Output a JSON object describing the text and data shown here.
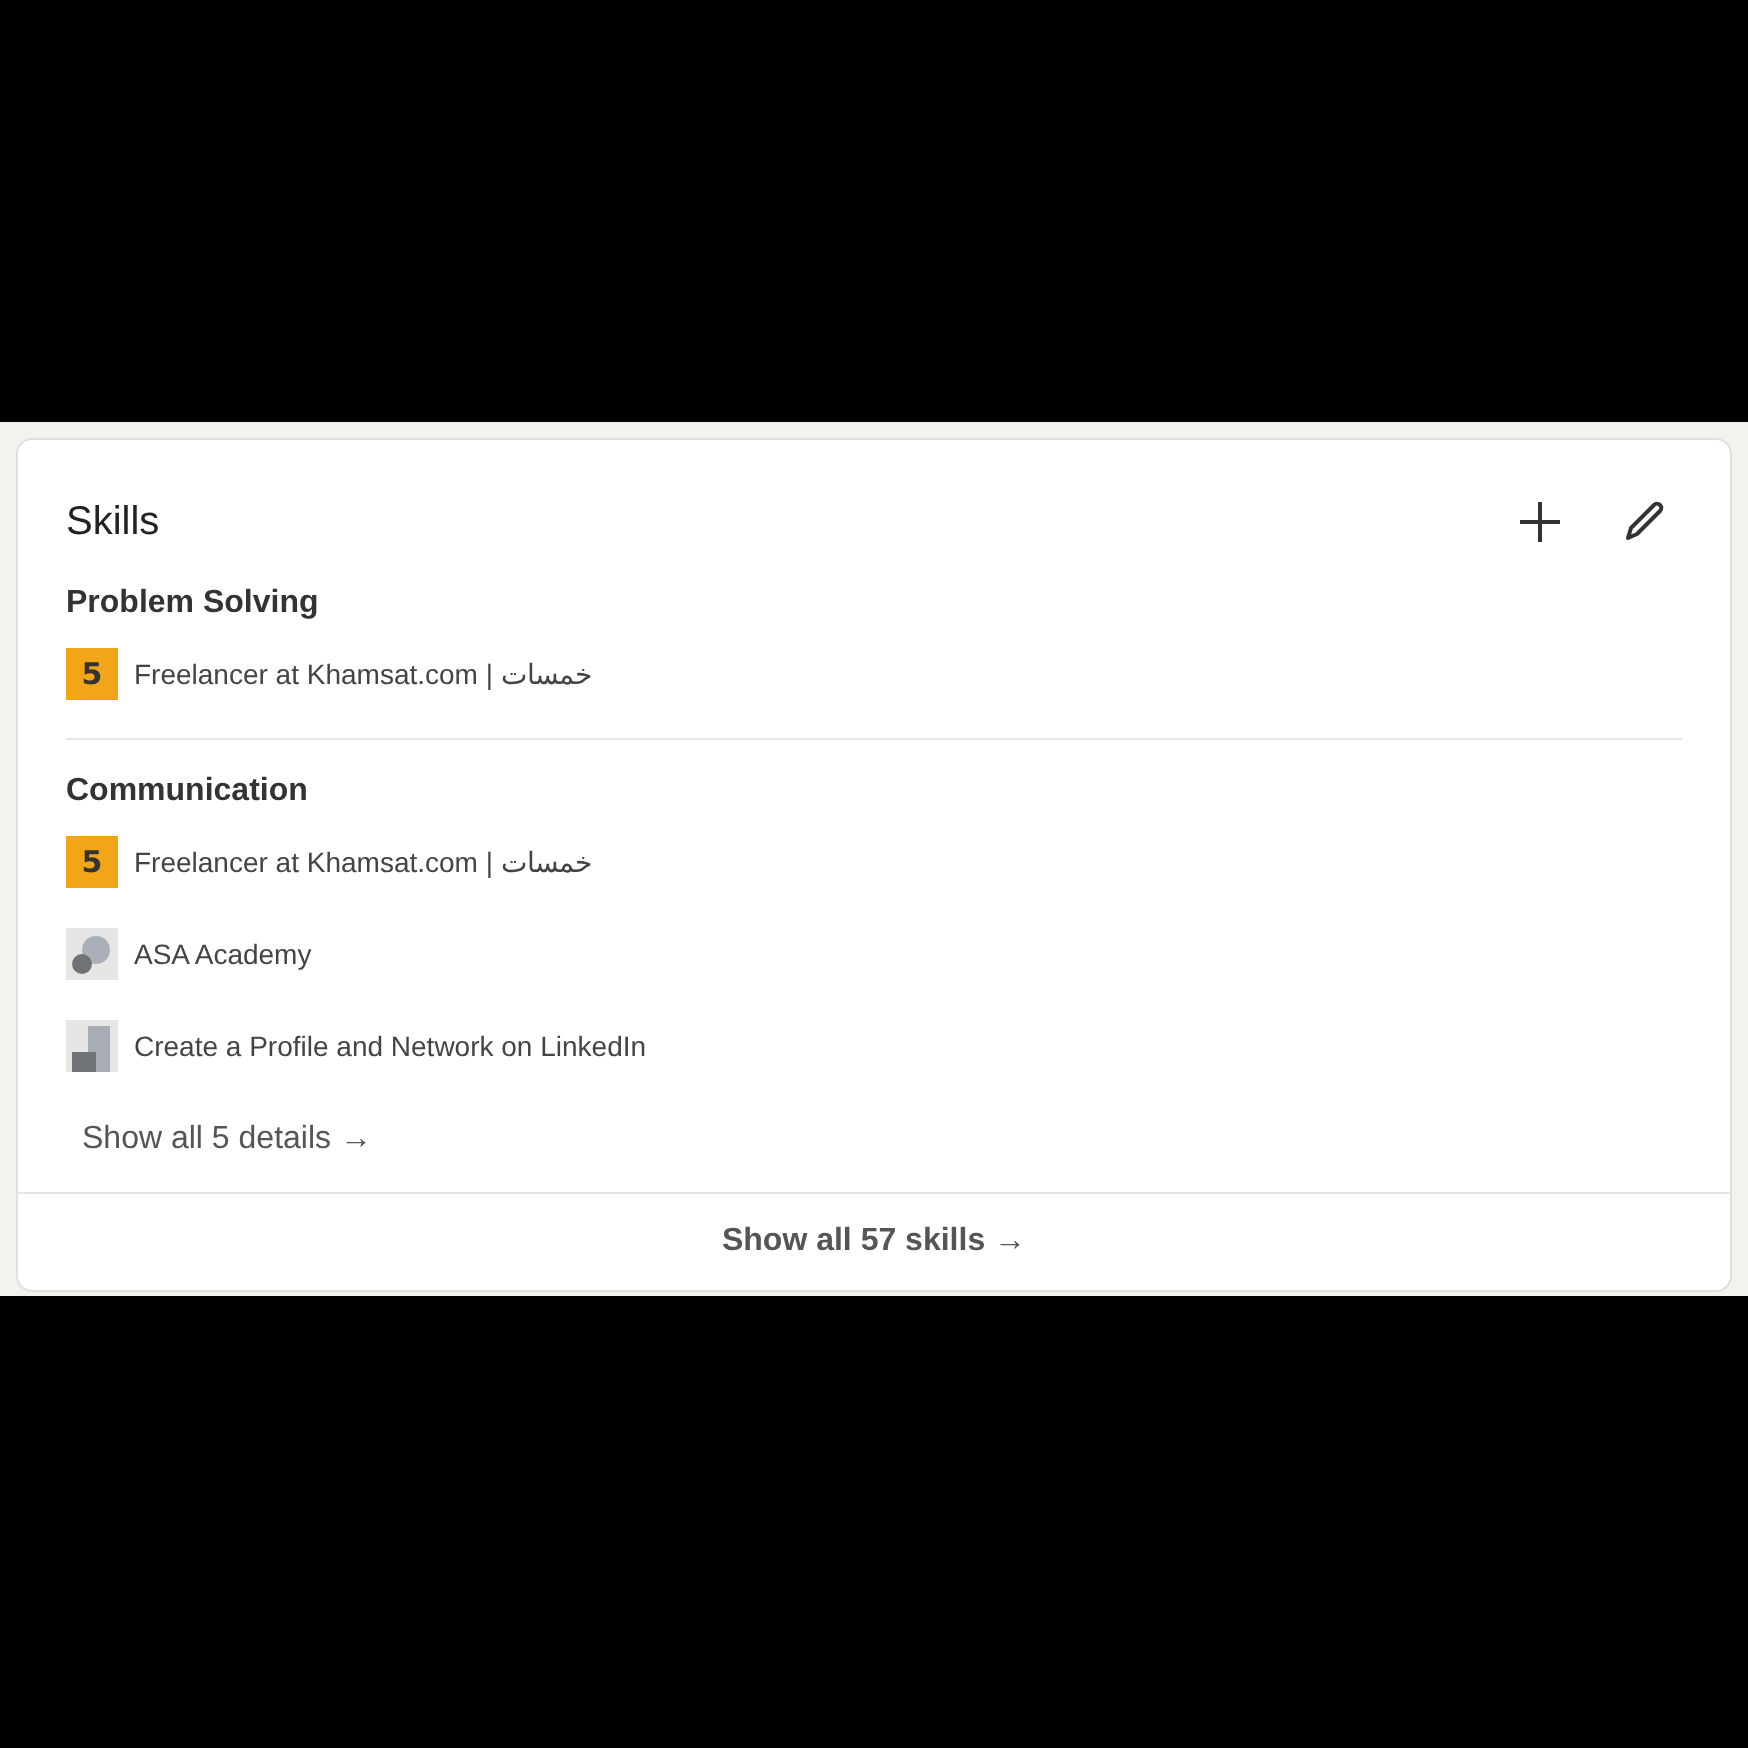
{
  "card": {
    "title": "Skills",
    "skills": [
      {
        "name": "Problem Solving",
        "items": [
          {
            "logo": {
              "kind": "letter",
              "text": "5"
            },
            "label": "Freelancer at Khamsat.com | خمسات"
          }
        ]
      },
      {
        "name": "Communication",
        "items": [
          {
            "logo": {
              "kind": "letter",
              "text": "5"
            },
            "label": "Freelancer at Khamsat.com | خمسات"
          },
          {
            "logo": {
              "kind": "circles"
            },
            "label": "ASA Academy"
          },
          {
            "logo": {
              "kind": "blocks"
            },
            "label": "Create a Profile and Network on LinkedIn"
          }
        ],
        "show_details": "Show all 5 details →"
      }
    ],
    "footer": "Show all 57 skills →"
  }
}
